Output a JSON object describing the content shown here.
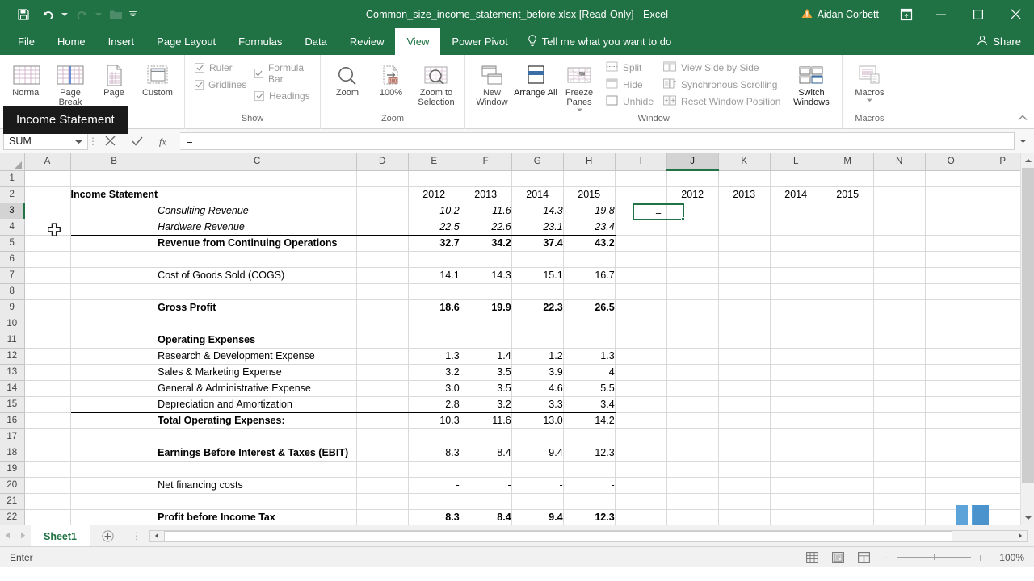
{
  "titlebar": {
    "document_title": "Common_size_income_statement_before.xlsx [Read-Only]  -  Excel",
    "user_name": "Aidan Corbett",
    "qat": [
      {
        "name": "save-icon",
        "label": "Save"
      },
      {
        "name": "undo-icon",
        "label": "Undo"
      },
      {
        "name": "redo-icon",
        "label": "Redo"
      },
      {
        "name": "open-icon",
        "label": "Open"
      },
      {
        "name": "customize-qat-icon",
        "label": "Customize Quick Access Toolbar"
      }
    ],
    "window_buttons": {
      "ribbon_display": "Ribbon Display Options",
      "minimize": "Minimize",
      "maximize": "Restore Down",
      "close": "Close"
    }
  },
  "tabs": [
    {
      "label": "File",
      "active": false
    },
    {
      "label": "Home",
      "active": false
    },
    {
      "label": "Insert",
      "active": false
    },
    {
      "label": "Page Layout",
      "active": false
    },
    {
      "label": "Formulas",
      "active": false
    },
    {
      "label": "Data",
      "active": false
    },
    {
      "label": "Review",
      "active": false
    },
    {
      "label": "View",
      "active": true
    },
    {
      "label": "Power Pivot",
      "active": false
    }
  ],
  "tellme": "Tell me what you want to do",
  "share": "Share",
  "tooltip": "Income Statement",
  "ribbon": {
    "groups": [
      {
        "name": "Workbook Views",
        "label": "",
        "buttons": [
          {
            "label": "Normal",
            "icon": "normal-view-icon"
          },
          {
            "label": "Page Break",
            "icon": "page-break-preview-icon"
          },
          {
            "label": "Page",
            "icon": "page-layout-icon"
          },
          {
            "label": "Custom",
            "icon": "custom-views-icon"
          }
        ]
      },
      {
        "name": "Show",
        "label": "Show",
        "checkboxes": [
          {
            "label": "Ruler",
            "checked": true
          },
          {
            "label": "Formula Bar",
            "checked": true
          },
          {
            "label": "Gridlines",
            "checked": true
          },
          {
            "label": "Headings",
            "checked": true
          }
        ]
      },
      {
        "name": "Zoom",
        "label": "Zoom",
        "buttons": [
          {
            "label": "Zoom",
            "icon": "zoom-icon"
          },
          {
            "label": "100%",
            "icon": "zoom-100-icon"
          },
          {
            "label": "Zoom to Selection",
            "icon": "zoom-to-selection-icon"
          }
        ]
      },
      {
        "name": "Window",
        "label": "Window",
        "buttons": [
          {
            "label": "New Window",
            "icon": "new-window-icon"
          },
          {
            "label": "Arrange All",
            "icon": "arrange-all-icon"
          },
          {
            "label": "Freeze Panes",
            "icon": "freeze-panes-icon"
          }
        ],
        "small_buttons": [
          {
            "label": "Split",
            "icon": "split-icon"
          },
          {
            "label": "Hide",
            "icon": "hide-icon"
          },
          {
            "label": "Unhide",
            "icon": "unhide-icon"
          },
          {
            "label": "View Side by Side",
            "icon": "view-side-by-side-icon"
          },
          {
            "label": "Synchronous Scrolling",
            "icon": "synchronous-scrolling-icon"
          },
          {
            "label": "Reset Window Position",
            "icon": "reset-window-position-icon"
          }
        ],
        "switch_windows": "Switch Windows"
      },
      {
        "name": "Macros",
        "label": "Macros",
        "buttons": [
          {
            "label": "Macros",
            "icon": "macros-icon"
          }
        ]
      }
    ]
  },
  "formula_bar": {
    "name_box_value": "SUM",
    "cancel_icon": "cancel-icon",
    "enter_icon": "confirm-icon",
    "function_icon": "insert-function-icon",
    "formula_value": "="
  },
  "grid": {
    "columns": [
      "A",
      "B",
      "C",
      "D",
      "E",
      "F",
      "G",
      "H",
      "I",
      "J",
      "K",
      "L",
      "M",
      "N",
      "O",
      "P"
    ],
    "selected_column": "J",
    "selected_row": 3,
    "active_cell_value": "=",
    "rows": [
      {
        "n": 1,
        "c": "",
        "d": [
          "",
          "",
          "",
          "",
          "",
          "",
          "",
          "",
          ""
        ]
      },
      {
        "n": 2,
        "c": "Income Statement",
        "d": [
          "",
          "2012",
          "2013",
          "2014",
          "2015",
          "",
          "2012",
          "2013",
          "2014",
          "2015"
        ]
      },
      {
        "n": 3,
        "c": "Consulting Revenue",
        "d": [
          "",
          "10.2",
          "11.6",
          "14.3",
          "19.8",
          "",
          "",
          "",
          "",
          ""
        ]
      },
      {
        "n": 4,
        "c": "Hardware  Revenue",
        "d": [
          "",
          "22.5",
          "22.6",
          "23.1",
          "23.4",
          "",
          "",
          "",
          "",
          ""
        ]
      },
      {
        "n": 5,
        "c": "Revenue from Continuing Operations",
        "d": [
          "",
          "32.7",
          "34.2",
          "37.4",
          "43.2",
          "",
          "",
          "",
          "",
          ""
        ]
      },
      {
        "n": 6,
        "c": "",
        "d": [
          "",
          "",
          "",
          "",
          "",
          "",
          "",
          "",
          ""
        ]
      },
      {
        "n": 7,
        "c": "Cost of Goods Sold (COGS)",
        "d": [
          "",
          "14.1",
          "14.3",
          "15.1",
          "16.7",
          "",
          "",
          "",
          "",
          ""
        ]
      },
      {
        "n": 8,
        "c": "",
        "d": [
          "",
          "",
          "",
          "",
          "",
          "",
          "",
          "",
          ""
        ]
      },
      {
        "n": 9,
        "c": "Gross Profit",
        "d": [
          "",
          "18.6",
          "19.9",
          "22.3",
          "26.5",
          "",
          "",
          "",
          "",
          ""
        ]
      },
      {
        "n": 10,
        "c": "",
        "d": [
          "",
          "",
          "",
          "",
          "",
          "",
          "",
          "",
          ""
        ]
      },
      {
        "n": 11,
        "c": "Operating Expenses",
        "d": [
          "",
          "",
          "",
          "",
          "",
          "",
          "",
          "",
          ""
        ]
      },
      {
        "n": 12,
        "c": "Research & Development Expense",
        "d": [
          "",
          "1.3",
          "1.4",
          "1.2",
          "1.3",
          "",
          "",
          "",
          "",
          ""
        ]
      },
      {
        "n": 13,
        "c": "Sales & Marketing Expense",
        "d": [
          "",
          "3.2",
          "3.5",
          "3.9",
          "4",
          "",
          "",
          "",
          "",
          ""
        ]
      },
      {
        "n": 14,
        "c": "General & Administrative Expense",
        "d": [
          "",
          "3.0",
          "3.5",
          "4.6",
          "5.5",
          "",
          "",
          "",
          "",
          ""
        ]
      },
      {
        "n": 15,
        "c": "Depreciation and Amortization",
        "d": [
          "",
          "2.8",
          "3.2",
          "3.3",
          "3.4",
          "",
          "",
          "",
          "",
          ""
        ]
      },
      {
        "n": 16,
        "c": "Total Operating Expenses:",
        "d": [
          "",
          "10.3",
          "11.6",
          "13.0",
          "14.2",
          "",
          "",
          "",
          "",
          ""
        ]
      },
      {
        "n": 17,
        "c": "",
        "d": [
          "",
          "",
          "",
          "",
          "",
          "",
          "",
          "",
          ""
        ]
      },
      {
        "n": 18,
        "c": "Earnings Before Interest & Taxes (EBIT)",
        "d": [
          "",
          "8.3",
          "8.4",
          "9.4",
          "12.3",
          "",
          "",
          "",
          "",
          ""
        ]
      },
      {
        "n": 19,
        "c": "",
        "d": [
          "",
          "",
          "",
          "",
          "",
          "",
          "",
          "",
          ""
        ]
      },
      {
        "n": 20,
        "c": "Net financing costs",
        "d": [
          "",
          "-",
          "-",
          "-",
          "-",
          "",
          "",
          "",
          "",
          ""
        ]
      },
      {
        "n": 21,
        "c": "",
        "d": [
          "",
          "",
          "",
          "",
          "",
          "",
          "",
          "",
          ""
        ]
      },
      {
        "n": 22,
        "c": "Profit before Income Tax",
        "d": [
          "",
          "8.3",
          "8.4",
          "9.4",
          "12.3",
          "",
          "",
          "",
          "",
          ""
        ]
      }
    ]
  },
  "sheet_tabs": {
    "tabs": [
      {
        "label": "Sheet1",
        "active": true
      }
    ],
    "add_label": "+"
  },
  "status_bar": {
    "mode": "Enter",
    "views": [
      {
        "name": "normal-view-button",
        "label": "Normal"
      },
      {
        "name": "page-layout-view-button",
        "label": "Page Layout"
      },
      {
        "name": "page-break-preview-button",
        "label": "Page Break Preview"
      }
    ],
    "zoom_out": "−",
    "zoom_in": "+",
    "zoom_level": "100%"
  },
  "colors": {
    "excel_green": "#207245",
    "accent_green": "#217346",
    "ribbon_bg": "#ffffff",
    "grid_line": "#d9d9d9",
    "header_bg": "#eaeaea"
  }
}
